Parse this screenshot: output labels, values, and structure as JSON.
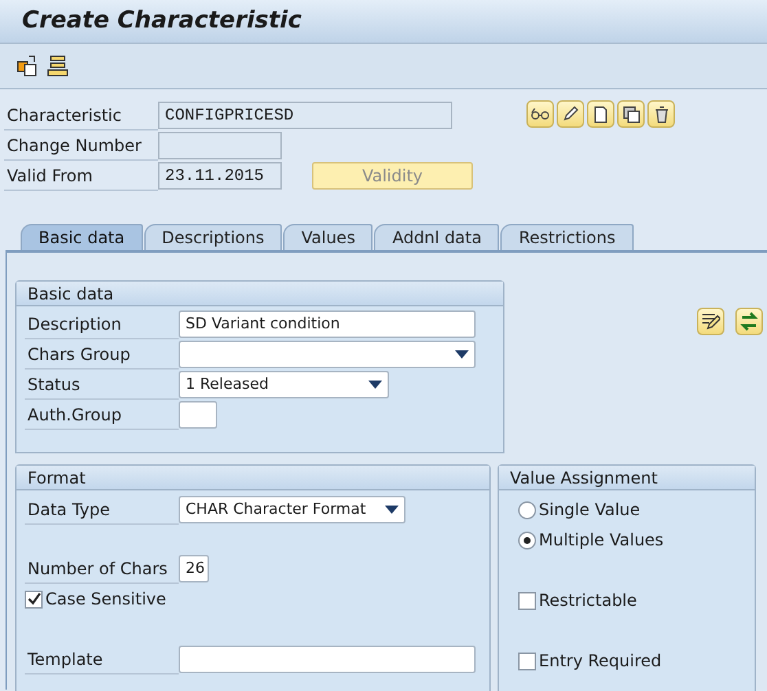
{
  "window": {
    "title": "Create Characteristic"
  },
  "header_fields": [
    {
      "label": "Characteristic",
      "value": "CONFIGPRICESD"
    },
    {
      "label": "Change Number"
    },
    {
      "label": "Valid From",
      "value": "23.11.2015"
    }
  ],
  "validity_button": {
    "label": "Validity",
    "disabled": true
  },
  "tabs": [
    {
      "label": "Basic data",
      "selected": true
    },
    {
      "label": "Descriptions",
      "selected": false
    },
    {
      "label": "Values",
      "selected": false
    },
    {
      "label": "Addnl data",
      "selected": false
    },
    {
      "label": "Restrictions",
      "selected": false
    }
  ],
  "basic_data": {
    "title": "Basic data",
    "fields": [
      {
        "kind": "field",
        "label": "Description",
        "value": "SD Variant condition"
      },
      {
        "kind": "dropdown",
        "label": "Chars Group"
      },
      {
        "kind": "dropdown",
        "label": "Status",
        "value": "1 Released"
      },
      {
        "kind": "field",
        "label": "Auth.Group"
      }
    ]
  },
  "format": {
    "title": "Format",
    "fields": [
      {
        "kind": "dropdown",
        "label": "Data Type",
        "value": "CHAR Character Format"
      },
      {
        "kind": "field",
        "label": "Number of Chars",
        "value": "26"
      },
      {
        "kind": "checkbox",
        "label": "Case Sensitive",
        "checked": true
      },
      {
        "kind": "field",
        "label": "Template"
      }
    ]
  },
  "value_assignment": {
    "title": "Value Assignment",
    "options": [
      {
        "kind": "radio",
        "label": "Single Value",
        "selected": false
      },
      {
        "kind": "radio",
        "label": "Multiple Values",
        "selected": true
      },
      {
        "kind": "checkbox",
        "label": "Restrictable",
        "checked": false
      },
      {
        "kind": "checkbox",
        "label": "Entry Required",
        "checked": false
      }
    ]
  }
}
